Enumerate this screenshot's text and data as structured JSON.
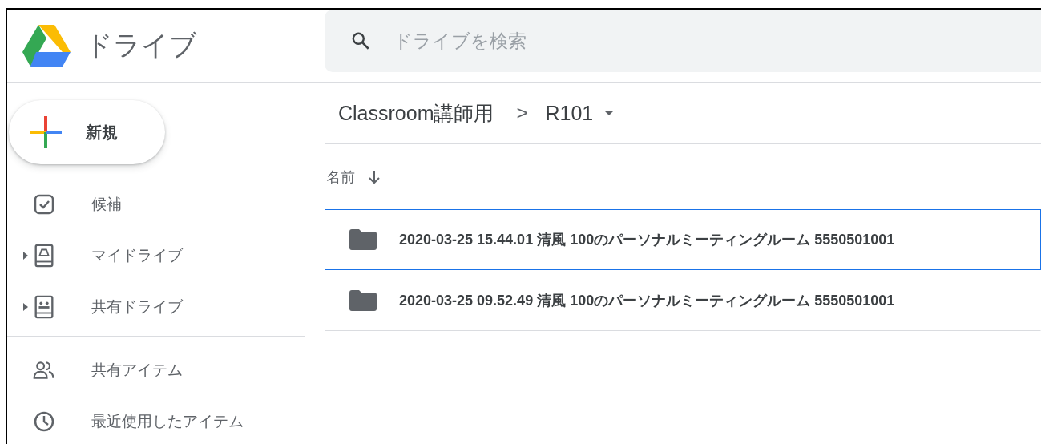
{
  "header": {
    "app_name": "ドライブ",
    "search": {
      "placeholder": "ドライブを検索"
    }
  },
  "sidebar": {
    "new_button": "新規",
    "sections": [
      [
        {
          "label": "候補",
          "expandable": false
        },
        {
          "label": "マイドライブ",
          "expandable": true
        },
        {
          "label": "共有ドライブ",
          "expandable": true
        }
      ],
      [
        {
          "label": "共有アイテム",
          "expandable": false
        },
        {
          "label": "最近使用したアイテム",
          "expandable": false
        }
      ]
    ]
  },
  "breadcrumb": {
    "parent": "Classroom講師用",
    "separator": ">",
    "current": "R101"
  },
  "file_list": {
    "sort_column": "名前",
    "rows": [
      {
        "name": "2020-03-25 15.44.01 清風 100のパーソナルミーティングルーム 5550501001",
        "selected": true
      },
      {
        "name": "2020-03-25 09.52.49 清風 100のパーソナルミーティングルーム 5550501001",
        "selected": false
      }
    ]
  }
}
